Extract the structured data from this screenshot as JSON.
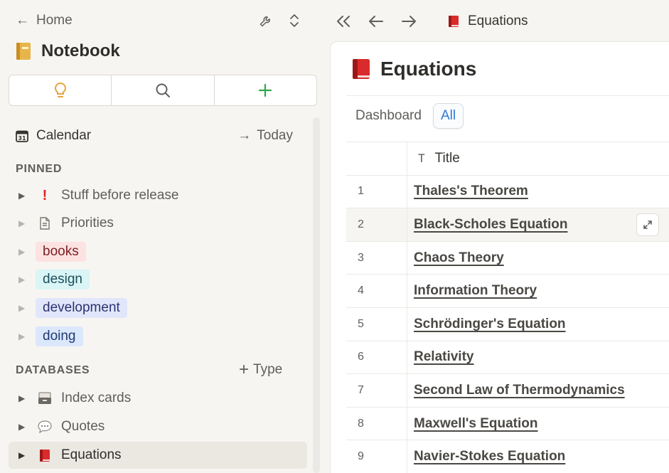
{
  "sidebar": {
    "home_label": "Home",
    "notebook_title": "Notebook",
    "calendar_label": "Calendar",
    "today_label": "Today",
    "pinned_header": "PINNED",
    "pinned_items": [
      {
        "label": "Stuff before release",
        "icon": "exclamation-icon"
      },
      {
        "label": "Priorities",
        "icon": "document-icon"
      },
      {
        "label": "books",
        "tag": true,
        "bg": "#fde2e2",
        "color": "#7a1f1f"
      },
      {
        "label": "design",
        "tag": true,
        "bg": "#d9f5f5",
        "color": "#1d4f5e"
      },
      {
        "label": "development",
        "tag": true,
        "bg": "#e2e6fa",
        "color": "#2a3470"
      },
      {
        "label": "doing",
        "tag": true,
        "bg": "#dbe7fb",
        "color": "#1f3b70"
      }
    ],
    "databases_header": "DATABASES",
    "type_label": "Type",
    "database_items": [
      {
        "label": "Index cards",
        "icon": "card-file-icon"
      },
      {
        "label": "Quotes",
        "icon": "speech-bubble-icon"
      },
      {
        "label": "Equations",
        "icon": "red-book-icon",
        "selected": true
      }
    ]
  },
  "breadcrumb": {
    "label": "Equations"
  },
  "page": {
    "title": "Equations",
    "tabs": [
      {
        "label": "Dashboard",
        "active": false
      },
      {
        "label": "All",
        "active": true
      }
    ],
    "table": {
      "column_title": "Title",
      "rows": [
        {
          "num": "1",
          "title": "Thales's Theorem"
        },
        {
          "num": "2",
          "title": "Black-Scholes Equation"
        },
        {
          "num": "3",
          "title": "Chaos Theory"
        },
        {
          "num": "4",
          "title": "Information Theory"
        },
        {
          "num": "5",
          "title": "Schrödinger's Equation"
        },
        {
          "num": "6",
          "title": "Relativity"
        },
        {
          "num": "7",
          "title": "Second Law of Thermodynamics"
        },
        {
          "num": "8",
          "title": "Maxwell's Equation"
        },
        {
          "num": "9",
          "title": "Navier-Stokes Equation"
        }
      ]
    }
  },
  "colors": {
    "accent_blue": "#2e7ad1",
    "add_green": "#2ea84a",
    "idea_orange": "#e8a33a"
  }
}
